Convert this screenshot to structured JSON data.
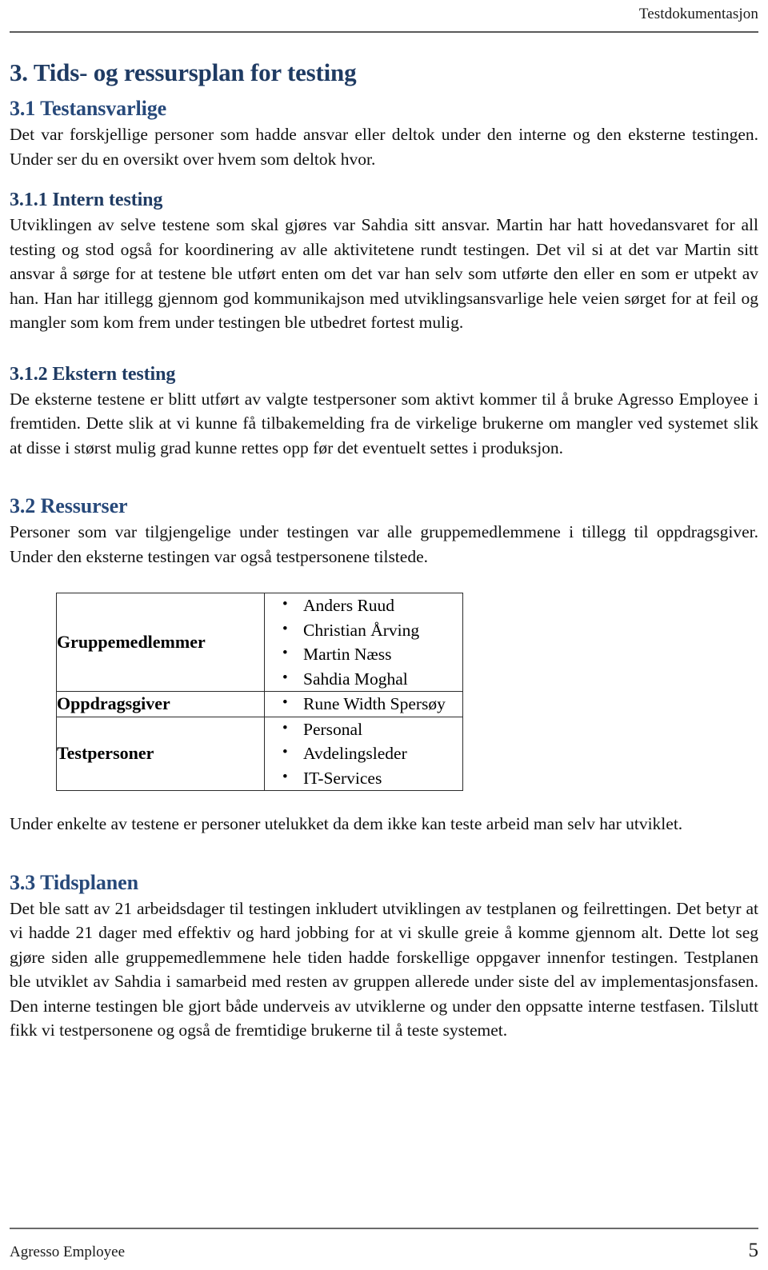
{
  "header": {
    "title": "Testdokumentasjon"
  },
  "headings": {
    "h1": "3. Tids- og ressursplan for testing",
    "h2_testansvarlige": "3.1 Testansvarlige",
    "h3_intern": "3.1.1 Intern testing",
    "h3_ekstern": "3.1.2 Ekstern testing",
    "h2_ressurser": "3.2 Ressurser",
    "h2_tidsplanen": "3.3 Tidsplanen"
  },
  "paragraphs": {
    "testansvarlige": "Det var forskjellige personer som hadde ansvar eller deltok under den interne og den eksterne testingen. Under ser du en oversikt over hvem som deltok hvor.",
    "intern": "Utviklingen av selve testene som skal gjøres var Sahdia sitt ansvar. Martin har hatt hovedansvaret for all testing og stod også for koordinering av alle aktivitetene rundt testingen. Det vil si at det var Martin sitt ansvar å sørge for at testene ble utført enten om det var han selv som utførte den eller en som er utpekt av han. Han har itillegg gjennom god kommunikajson med utviklingsansvarlige hele veien sørget for at feil og mangler som kom frem under testingen ble utbedret fortest mulig.",
    "ekstern": "De eksterne testene er blitt utført av valgte testpersoner som aktivt kommer til å bruke Agresso Employee i fremtiden. Dette slik at vi kunne få tilbakemelding fra de virkelige brukerne om mangler ved systemet slik at disse i størst mulig grad kunne rettes opp før det eventuelt settes i produksjon.",
    "ressurser": "Personer som var tilgjengelige under testingen var alle gruppemedlemmene i tillegg til oppdragsgiver. Under den eksterne testingen var også testpersonene tilstede.",
    "after_table": "Under enkelte av testene er personer utelukket da dem ikke kan teste arbeid man selv har utviklet.",
    "tidsplanen": "Det ble satt av 21 arbeidsdager til testingen inkludert utviklingen av testplanen og feilrettingen. Det betyr at vi hadde 21 dager med effektiv og hard jobbing for at vi skulle greie å komme gjennom alt. Dette lot seg gjøre siden alle gruppemedlemmene hele tiden hadde forskellige oppgaver innenfor testingen. Testplanen ble utviklet av Sahdia i samarbeid med resten av gruppen allerede under siste del av implementasjonsfasen. Den interne testingen ble gjort både underveis av utviklerne og under den oppsatte interne testfasen. Tilslutt fikk vi testpersonene og også de fremtidige brukerne til å teste systemet."
  },
  "resources_table": {
    "rows": [
      {
        "label": "Gruppemedlemmer",
        "items": [
          "Anders Ruud",
          "Christian Årving",
          "Martin Næss",
          "Sahdia Moghal"
        ]
      },
      {
        "label": "Oppdragsgiver",
        "items": [
          "Rune Width Spersøy"
        ]
      },
      {
        "label": "Testpersoner",
        "items": [
          "Personal",
          "Avdelingsleder",
          "IT-Services"
        ]
      }
    ]
  },
  "footer": {
    "left": "Agresso Employee",
    "page_number": "5"
  },
  "colors": {
    "heading_navy": "#1f3b63",
    "subheading_blue": "#27497a",
    "rule_gray": "#5a5a5a",
    "table_border": "#2b2b2b"
  }
}
